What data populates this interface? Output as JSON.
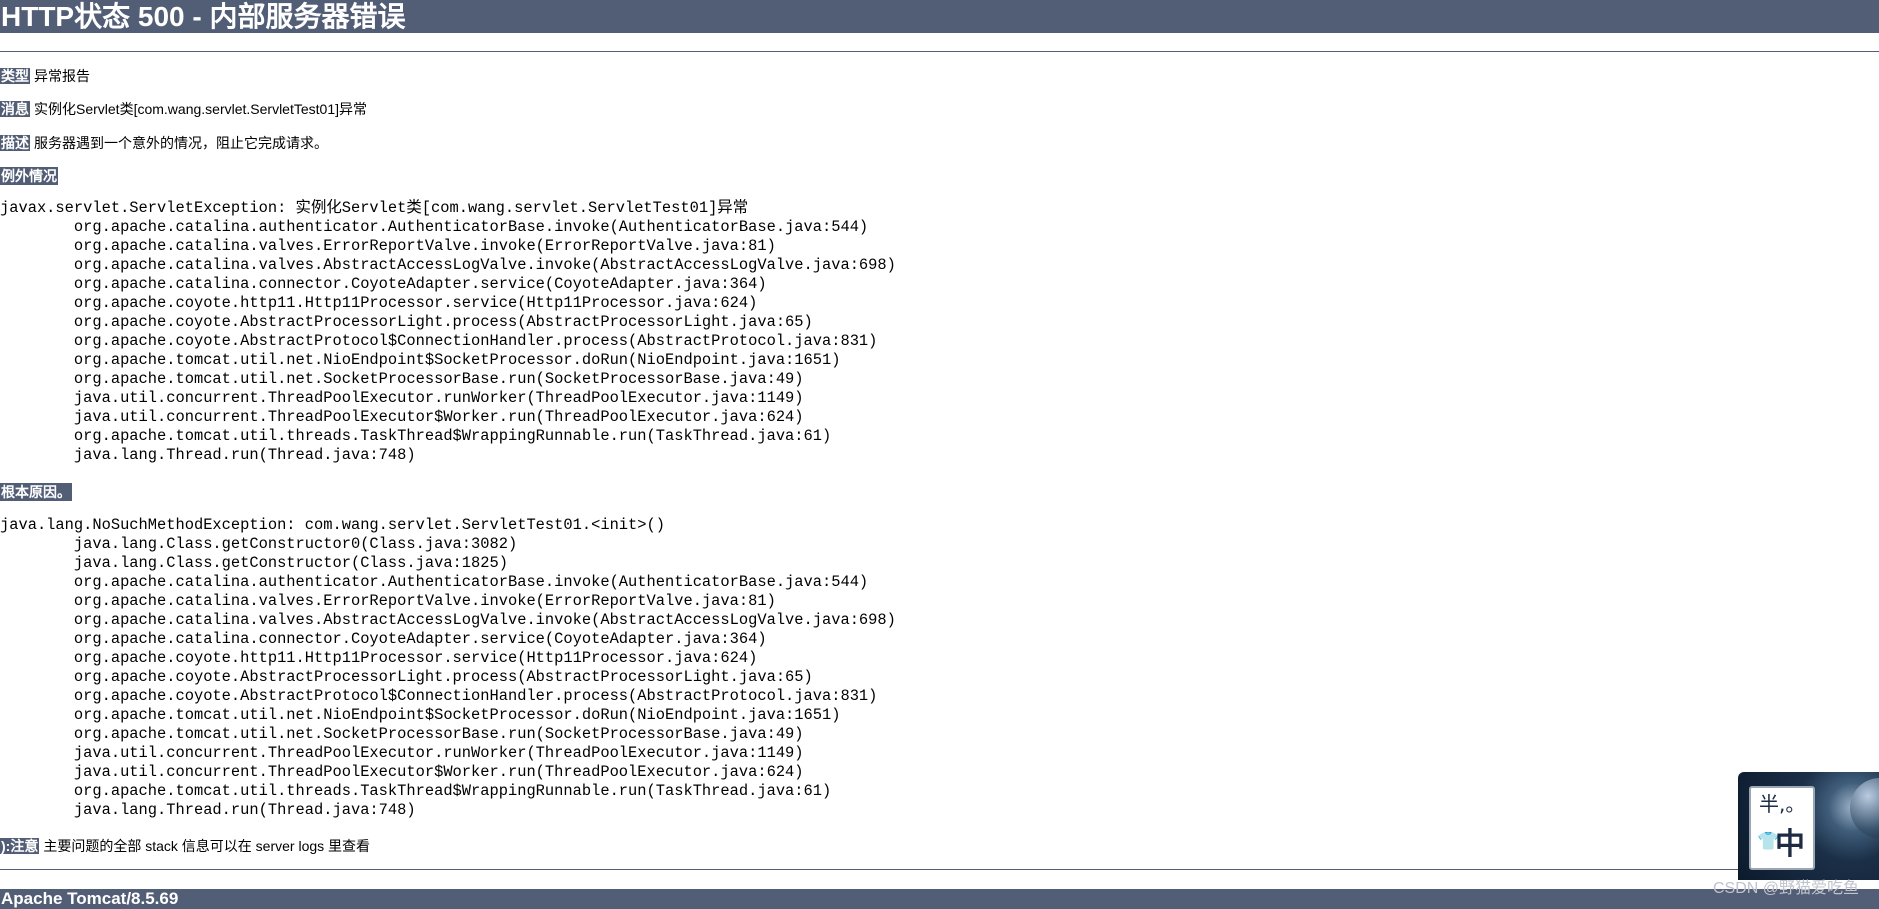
{
  "header": {
    "title": "HTTP状态 500 - 内部服务器错误"
  },
  "report": {
    "type_label": "类型",
    "type_value": "异常报告",
    "message_label": "消息",
    "message_value": "实例化Servlet类[com.wang.servlet.ServletTest01]异常",
    "description_label": "描述",
    "description_value": "服务器遇到一个意外的情况，阻止它完成请求。"
  },
  "exception": {
    "label": "例外情况",
    "stack_lines": [
      "javax.servlet.ServletException: 实例化Servlet类[com.wang.servlet.ServletTest01]异常",
      "\torg.apache.catalina.authenticator.AuthenticatorBase.invoke(AuthenticatorBase.java:544)",
      "\torg.apache.catalina.valves.ErrorReportValve.invoke(ErrorReportValve.java:81)",
      "\torg.apache.catalina.valves.AbstractAccessLogValve.invoke(AbstractAccessLogValve.java:698)",
      "\torg.apache.catalina.connector.CoyoteAdapter.service(CoyoteAdapter.java:364)",
      "\torg.apache.coyote.http11.Http11Processor.service(Http11Processor.java:624)",
      "\torg.apache.coyote.AbstractProcessorLight.process(AbstractProcessorLight.java:65)",
      "\torg.apache.coyote.AbstractProtocol$ConnectionHandler.process(AbstractProtocol.java:831)",
      "\torg.apache.tomcat.util.net.NioEndpoint$SocketProcessor.doRun(NioEndpoint.java:1651)",
      "\torg.apache.tomcat.util.net.SocketProcessorBase.run(SocketProcessorBase.java:49)",
      "\tjava.util.concurrent.ThreadPoolExecutor.runWorker(ThreadPoolExecutor.java:1149)",
      "\tjava.util.concurrent.ThreadPoolExecutor$Worker.run(ThreadPoolExecutor.java:624)",
      "\torg.apache.tomcat.util.threads.TaskThread$WrappingRunnable.run(TaskThread.java:61)",
      "\tjava.lang.Thread.run(Thread.java:748)"
    ]
  },
  "root_cause": {
    "label": "根本原因。",
    "stack_lines": [
      "java.lang.NoSuchMethodException: com.wang.servlet.ServletTest01.<init>()",
      "\tjava.lang.Class.getConstructor0(Class.java:3082)",
      "\tjava.lang.Class.getConstructor(Class.java:1825)",
      "\torg.apache.catalina.authenticator.AuthenticatorBase.invoke(AuthenticatorBase.java:544)",
      "\torg.apache.catalina.valves.ErrorReportValve.invoke(ErrorReportValve.java:81)",
      "\torg.apache.catalina.valves.AbstractAccessLogValve.invoke(AbstractAccessLogValve.java:698)",
      "\torg.apache.catalina.connector.CoyoteAdapter.service(CoyoteAdapter.java:364)",
      "\torg.apache.coyote.http11.Http11Processor.service(Http11Processor.java:624)",
      "\torg.apache.coyote.AbstractProcessorLight.process(AbstractProcessorLight.java:65)",
      "\torg.apache.coyote.AbstractProtocol$ConnectionHandler.process(AbstractProtocol.java:831)",
      "\torg.apache.tomcat.util.net.NioEndpoint$SocketProcessor.doRun(NioEndpoint.java:1651)",
      "\torg.apache.tomcat.util.net.SocketProcessorBase.run(SocketProcessorBase.java:49)",
      "\tjava.util.concurrent.ThreadPoolExecutor.runWorker(ThreadPoolExecutor.java:1149)",
      "\tjava.util.concurrent.ThreadPoolExecutor$Worker.run(ThreadPoolExecutor.java:624)",
      "\torg.apache.tomcat.util.threads.TaskThread$WrappingRunnable.run(TaskThread.java:61)",
      "\tjava.lang.Thread.run(Thread.java:748)"
    ]
  },
  "note": {
    "label": "):注意",
    "text": "主要问题的全部 stack 信息可以在 server logs 里查看"
  },
  "footer": {
    "server": "Apache Tomcat/8.5.69"
  },
  "watermark": {
    "text": "CSDN @野猫爱吃鱼"
  },
  "ime_widget": {
    "top_text": "半,。",
    "shirt_glyph": "👕",
    "mode_text": "中"
  },
  "colors": {
    "accent": "#525d76",
    "background": "#ffffff",
    "text": "#000000"
  }
}
